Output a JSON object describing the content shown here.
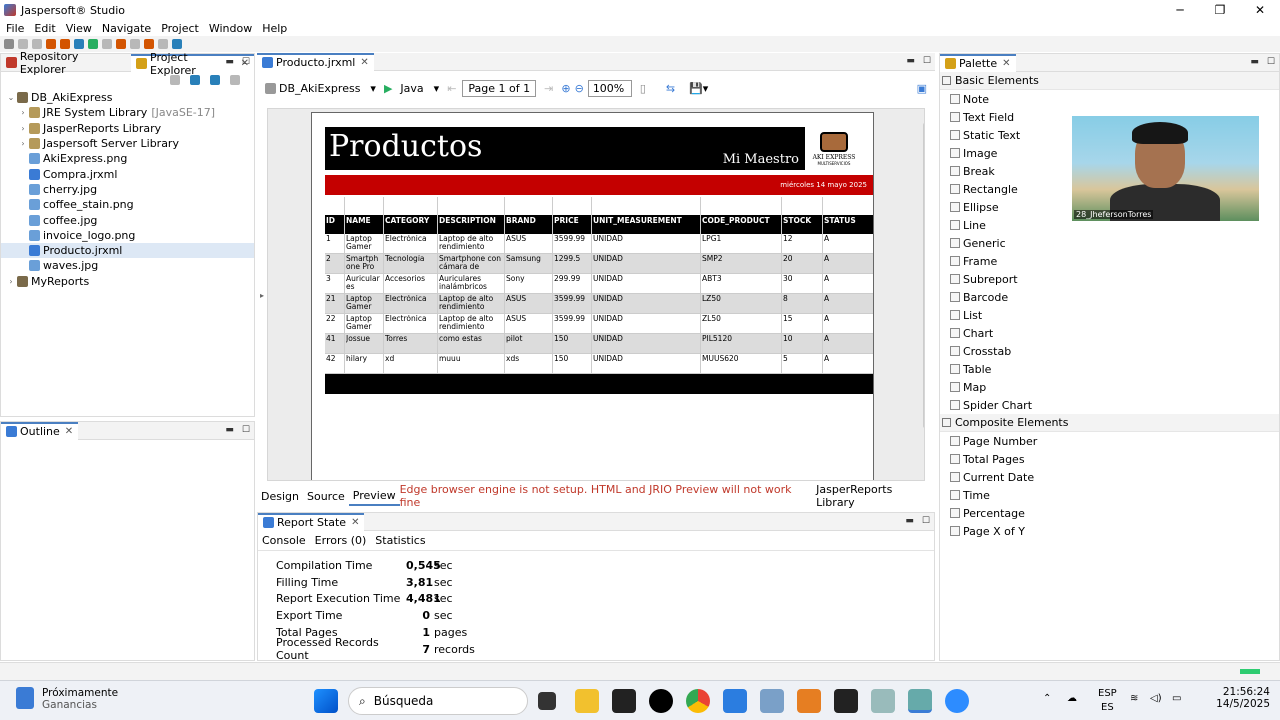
{
  "window": {
    "title": "Jaspersoft® Studio"
  },
  "menu": [
    "File",
    "Edit",
    "View",
    "Navigate",
    "Project",
    "Window",
    "Help"
  ],
  "left_panel": {
    "tabs": [
      "Repository Explorer",
      "Project Explorer"
    ],
    "tree": [
      {
        "label": "DB_AkiExpress",
        "level": 0,
        "arrow": "⌄"
      },
      {
        "label": "JRE System Library",
        "suffix": "[JavaSE-17]",
        "level": 1,
        "arrow": "›"
      },
      {
        "label": "JasperReports Library",
        "level": 1,
        "arrow": "›"
      },
      {
        "label": "Jaspersoft Server Library",
        "level": 1,
        "arrow": "›"
      },
      {
        "label": "AkiExpress.png",
        "level": 1
      },
      {
        "label": "Compra.jrxml",
        "level": 1
      },
      {
        "label": "cherry.jpg",
        "level": 1
      },
      {
        "label": "coffee_stain.png",
        "level": 1
      },
      {
        "label": "coffee.jpg",
        "level": 1
      },
      {
        "label": "invoice_logo.png",
        "level": 1
      },
      {
        "label": "Producto.jrxml",
        "level": 1,
        "selected": true
      },
      {
        "label": "waves.jpg",
        "level": 1
      },
      {
        "label": "MyReports",
        "level": 0,
        "arrow": "›"
      }
    ]
  },
  "outline": {
    "tab": "Outline"
  },
  "editor": {
    "tab": "Producto.jrxml",
    "datasource": "DB_AkiExpress",
    "language": "Java",
    "page": "Page 1 of 1",
    "zoom": "100%",
    "bottom_tabs": [
      "Design",
      "Source",
      "Preview"
    ],
    "warning": "Edge browser engine is not setup. HTML and JRIO Preview will not work fine",
    "library_tab": "JasperReports Library"
  },
  "report": {
    "title": "Productos",
    "subtitle": "Mi Maestro",
    "date": "miércoles 14 mayo 2025",
    "logo_text": "AKI EXPRESS",
    "logo_sub": "MULTISERVICIOS",
    "columns": [
      "ID",
      "NAME",
      "CATEGORY",
      "DESCRIPTION",
      "BRAND",
      "PRICE",
      "UNIT_MEASUREMENT",
      "CODE_PRODUCT",
      "STOCK",
      "STATUS"
    ],
    "rows": [
      [
        "1",
        "Laptop Gamer",
        "Electrónica",
        "Laptop de alto rendimiento",
        "ASUS",
        "3599.99",
        "UNIDAD",
        "LPG1",
        "12",
        "A"
      ],
      [
        "2",
        "Smartph one Pro",
        "Tecnología",
        "Smartphone con cámara de",
        "Samsung",
        "1299.5",
        "UNIDAD",
        "SMP2",
        "20",
        "A"
      ],
      [
        "3",
        "Auricular es",
        "Accesorios",
        "Auriculares inalámbricos",
        "Sony",
        "299.99",
        "UNIDAD",
        "ABT3",
        "30",
        "A"
      ],
      [
        "21",
        "Laptop Gamer",
        "Electrónica",
        "Laptop de alto rendimiento",
        "ASUS",
        "3599.99",
        "UNIDAD",
        "LZ50",
        "8",
        "A"
      ],
      [
        "22",
        "Laptop Gamer",
        "Electrónica",
        "Laptop de alto rendimiento",
        "ASUS",
        "3599.99",
        "UNIDAD",
        "ZL50",
        "15",
        "A"
      ],
      [
        "41",
        "Jossue",
        "Torres",
        "como estas",
        "pilot",
        "150",
        "UNIDAD",
        "PIL5120",
        "10",
        "A"
      ],
      [
        "42",
        "hilary",
        "xd",
        "muuu",
        "xds",
        "150",
        "UNIDAD",
        "MUUS620",
        "5",
        "A"
      ]
    ]
  },
  "report_state": {
    "tab": "Report State",
    "subtabs": [
      "Console",
      "Errors (0)",
      "Statistics"
    ],
    "stats": [
      {
        "label": "Compilation Time",
        "value": "0,545",
        "unit": "sec"
      },
      {
        "label": "Filling Time",
        "value": "3,81",
        "unit": "sec"
      },
      {
        "label": "Report Execution Time",
        "value": "4,481",
        "unit": "sec"
      },
      {
        "label": "Export Time",
        "value": "0",
        "unit": "sec"
      },
      {
        "label": "Total Pages",
        "value": "1",
        "unit": "pages"
      },
      {
        "label": "Processed Records Count",
        "value": "7",
        "unit": "records"
      }
    ]
  },
  "palette": {
    "tab": "Palette",
    "basic_title": "Basic Elements",
    "basic": [
      "Note",
      "Text Field",
      "Static Text",
      "Image",
      "Break",
      "Rectangle",
      "Ellipse",
      "Line",
      "Generic",
      "Frame",
      "Subreport",
      "Barcode",
      "List",
      "Chart",
      "Crosstab",
      "Table",
      "Map",
      "Spider Chart"
    ],
    "composite_title": "Composite Elements",
    "composite": [
      "Page Number",
      "Total Pages",
      "Current Date",
      "Time",
      "Percentage",
      "Page X of Y"
    ]
  },
  "webcam": {
    "name": "28_JhefersonTorres"
  },
  "taskbar": {
    "weather_title": "Próximamente",
    "weather_sub": "Ganancias",
    "search": "Búsqueda",
    "lang1": "ESP",
    "lang2": "ES",
    "time": "21:56:24",
    "date": "14/5/2025"
  }
}
